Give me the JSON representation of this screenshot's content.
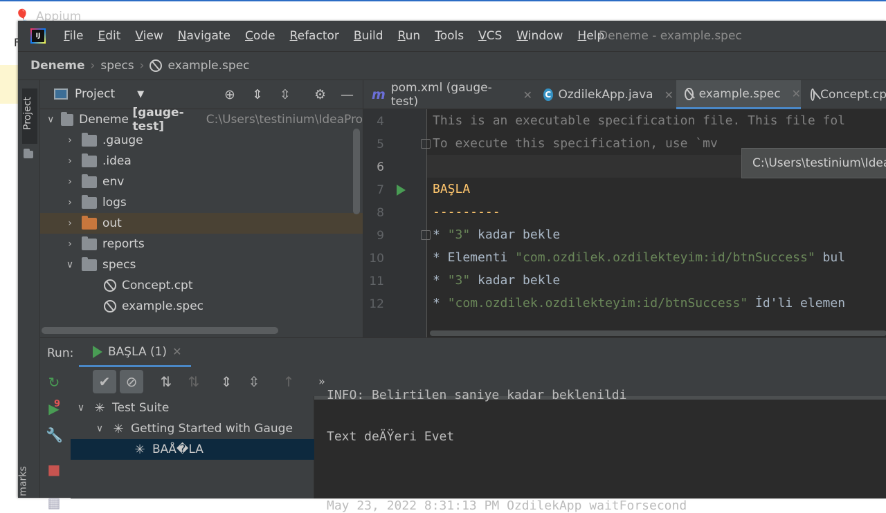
{
  "background_app": {
    "title": "Appium",
    "left_letter": "F"
  },
  "menu": {
    "items": [
      "File",
      "Edit",
      "View",
      "Navigate",
      "Code",
      "Refactor",
      "Build",
      "Run",
      "Tools",
      "VCS",
      "Window",
      "Help"
    ],
    "title": "Deneme - example.spec"
  },
  "breadcrumb": {
    "project": "Deneme",
    "folder": "specs",
    "file": "example.spec"
  },
  "project_panel": {
    "title": "Project",
    "stripe_label": "Project",
    "bookmarks_label": "marks",
    "root": {
      "name": "Deneme",
      "module": "[gauge-test]",
      "path": "C:\\Users\\testinium\\IdeaPro"
    },
    "folders": [
      ".gauge",
      ".idea",
      "env",
      "logs",
      "out",
      "reports",
      "specs"
    ],
    "spec_files": [
      "Concept.cpt",
      "example.spec"
    ]
  },
  "editor": {
    "tabs": [
      "pom.xml (gauge-test)",
      "OzdilekApp.java",
      "example.spec",
      "Concept.cp"
    ],
    "tooltip": "C:\\Users\\testinium\\IdeaP",
    "line_numbers": [
      "4",
      "5",
      "6",
      "7",
      "8",
      "9",
      "10",
      "11",
      "12"
    ],
    "lines": {
      "l4": "This is an executable specification file. This file fol",
      "l5": "To execute this specification, use `mv",
      "l6": "",
      "l7": "BAŞLA",
      "l8": "---------",
      "l9_a": "* ",
      "l9_b": "\"3\"",
      "l9_c": " kadar bekle",
      "l10_a": "* Elementi ",
      "l10_b": "\"com.ozdilek.ozdilekteyim:id/btnSuccess\"",
      "l10_c": " bul",
      "l11_a": "* ",
      "l11_b": "\"3\"",
      "l11_c": " kadar bekle",
      "l12_a": "* ",
      "l12_b": "\"com.ozdilek.ozdilekteyim:id/btnSuccess\"",
      "l12_c": " İd'li elemen"
    }
  },
  "run_panel": {
    "label": "Run:",
    "tab": "BAŞLA (1)",
    "tree": [
      "Test Suite",
      "Getting Started with Gauge",
      "BAÅ�LA"
    ],
    "console": {
      "c1": "INFO: Belirtilen saniye kadar beklenildi",
      "c2": "Text deÄŸeri Evet",
      "c3": "May 23, 2022 8:31:13 PM OzdilekApp waitForsecond"
    },
    "badge": "9"
  },
  "colors": {
    "accent": "#4a88c7",
    "run_green": "#499c54",
    "heading": "#ffc66d",
    "string": "#6a8759"
  }
}
